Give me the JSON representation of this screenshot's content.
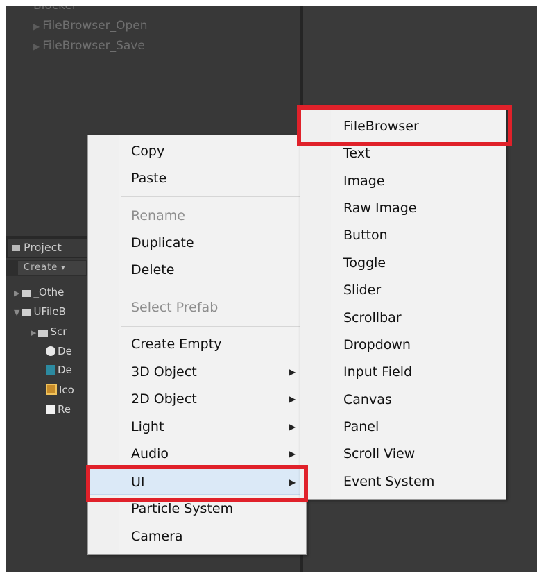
{
  "hierarchy": {
    "items": [
      {
        "label": "Blocker"
      },
      {
        "label": "FileBrowser_Open"
      },
      {
        "label": "FileBrowser_Save"
      }
    ]
  },
  "project": {
    "tab_label": "Project",
    "create_label": "Create",
    "items": [
      {
        "label": "_Othe",
        "icon": "folder-icon"
      },
      {
        "label": "UFileB",
        "icon": "folder-icon"
      },
      {
        "label": "Scr",
        "icon": "folder-icon"
      },
      {
        "label": "De",
        "icon": "unity-icon"
      },
      {
        "label": "De",
        "icon": "csharp-icon"
      },
      {
        "label": "Ico",
        "icon": "image-icon"
      },
      {
        "label": "Re",
        "icon": "pdf-icon"
      }
    ]
  },
  "context_menu": {
    "items": [
      {
        "label": "Copy"
      },
      {
        "label": "Paste"
      },
      {
        "label": "Rename"
      },
      {
        "label": "Duplicate"
      },
      {
        "label": "Delete"
      },
      {
        "label": "Select Prefab"
      },
      {
        "label": "Create Empty"
      },
      {
        "label": "3D Object"
      },
      {
        "label": "2D Object"
      },
      {
        "label": "Light"
      },
      {
        "label": "Audio"
      },
      {
        "label": "UI"
      },
      {
        "label": "Particle System"
      },
      {
        "label": "Camera"
      }
    ]
  },
  "submenu": {
    "items": [
      {
        "label": "FileBrowser"
      },
      {
        "label": "Text"
      },
      {
        "label": "Image"
      },
      {
        "label": "Raw Image"
      },
      {
        "label": "Button"
      },
      {
        "label": "Toggle"
      },
      {
        "label": "Slider"
      },
      {
        "label": "Scrollbar"
      },
      {
        "label": "Dropdown"
      },
      {
        "label": "Input Field"
      },
      {
        "label": "Canvas"
      },
      {
        "label": "Panel"
      },
      {
        "label": "Scroll View"
      },
      {
        "label": "Event System"
      }
    ]
  },
  "colors": {
    "editor_bg": "#383838",
    "menu_bg": "#f2f2f2",
    "highlight_box": "#e0212a",
    "hover": "#dbe9f7"
  }
}
